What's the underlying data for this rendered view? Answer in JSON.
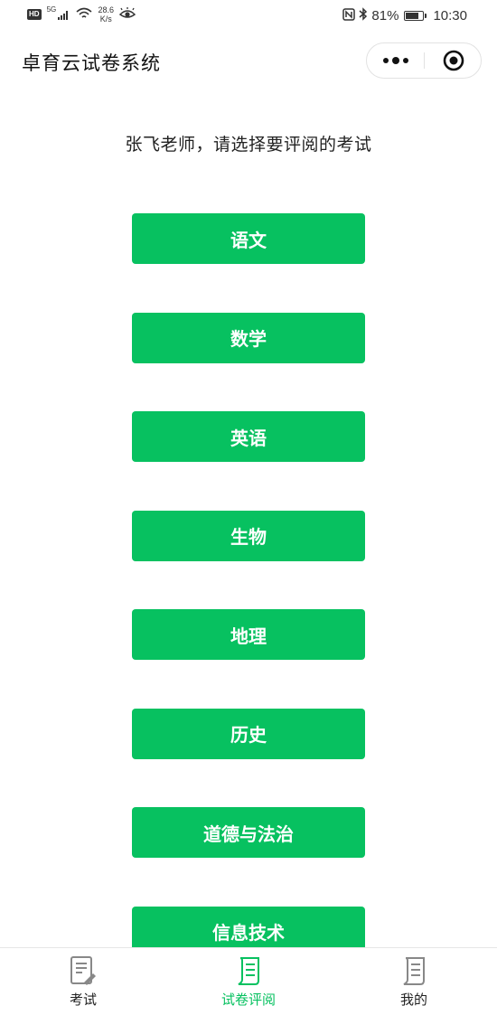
{
  "status_bar": {
    "hd": "HD",
    "network": "5G",
    "speed_value": "28.6",
    "speed_unit": "K/s",
    "nfc": "N",
    "battery_percent": "81%",
    "time": "10:30"
  },
  "nav": {
    "title": "卓育云试卷系统"
  },
  "prompt": "张飞老师，请选择要评阅的考试",
  "subjects": [
    "语文",
    "数学",
    "英语",
    "生物",
    "地理",
    "历史",
    "道德与法治",
    "信息技术"
  ],
  "tabs": [
    {
      "label": "考试",
      "icon": "exam-icon",
      "active": false
    },
    {
      "label": "试卷评阅",
      "icon": "paper-review-icon",
      "active": true
    },
    {
      "label": "我的",
      "icon": "profile-document-icon",
      "active": false
    }
  ],
  "colors": {
    "accent": "#07c160",
    "text": "#222222",
    "inactive_icon": "#888888"
  }
}
